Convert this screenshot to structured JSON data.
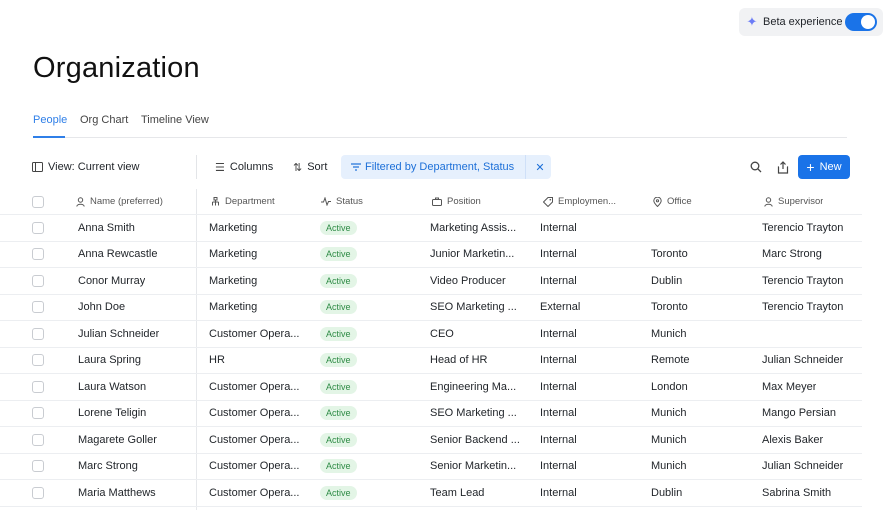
{
  "beta": {
    "label": "Beta experience",
    "enabled": true
  },
  "page": {
    "title": "Organization"
  },
  "tabs": [
    {
      "label": "People",
      "active": true
    },
    {
      "label": "Org Chart",
      "active": false
    },
    {
      "label": "Timeline View",
      "active": false
    }
  ],
  "toolbar": {
    "view_label": "View: Current view",
    "columns_label": "Columns",
    "sort_label": "Sort",
    "filter_label": "Filtered by Department, Status",
    "new_label": "New"
  },
  "columns": [
    "Name (preferred)",
    "Department",
    "Status",
    "Position",
    "Employmen...",
    "Office",
    "Supervisor"
  ],
  "rows": [
    {
      "name": "Anna Smith",
      "department": "Marketing",
      "status": "Active",
      "position": "Marketing Assis...",
      "employment": "Internal",
      "office": "",
      "supervisor": "Terencio Trayton"
    },
    {
      "name": "Anna Rewcastle",
      "department": "Marketing",
      "status": "Active",
      "position": "Junior Marketin...",
      "employment": "Internal",
      "office": "Toronto",
      "supervisor": "Marc Strong"
    },
    {
      "name": "Conor Murray",
      "department": "Marketing",
      "status": "Active",
      "position": "Video Producer",
      "employment": "Internal",
      "office": "Dublin",
      "supervisor": "Terencio Trayton"
    },
    {
      "name": "John Doe",
      "department": "Marketing",
      "status": "Active",
      "position": "SEO Marketing ...",
      "employment": "External",
      "office": "Toronto",
      "supervisor": "Terencio Trayton"
    },
    {
      "name": "Julian Schneider",
      "department": "Customer Opera...",
      "status": "Active",
      "position": "CEO",
      "employment": "Internal",
      "office": "Munich",
      "supervisor": ""
    },
    {
      "name": "Laura Spring",
      "department": "HR",
      "status": "Active",
      "position": "Head of HR",
      "employment": "Internal",
      "office": "Remote",
      "supervisor": "Julian Schneider"
    },
    {
      "name": "Laura Watson",
      "department": "Customer Opera...",
      "status": "Active",
      "position": "Engineering Ma...",
      "employment": "Internal",
      "office": "London",
      "supervisor": "Max Meyer"
    },
    {
      "name": "Lorene Teligin",
      "department": "Customer Opera...",
      "status": "Active",
      "position": "SEO Marketing ...",
      "employment": "Internal",
      "office": "Munich",
      "supervisor": "Mango Persian"
    },
    {
      "name": "Magarete Goller",
      "department": "Customer Opera...",
      "status": "Active",
      "position": "Senior Backend ...",
      "employment": "Internal",
      "office": "Munich",
      "supervisor": "Alexis Baker"
    },
    {
      "name": "Marc Strong",
      "department": "Customer Opera...",
      "status": "Active",
      "position": "Senior Marketin...",
      "employment": "Internal",
      "office": "Munich",
      "supervisor": "Julian Schneider"
    },
    {
      "name": "Maria Matthews",
      "department": "Customer Opera...",
      "status": "Active",
      "position": "Team Lead",
      "employment": "Internal",
      "office": "Dublin",
      "supervisor": "Sabrina Smith"
    }
  ],
  "colors": {
    "accent": "#1a73e8",
    "badge_bg": "#e3f5e6",
    "badge_text": "#2e8b45",
    "filter_bg": "#e6f0fd"
  }
}
